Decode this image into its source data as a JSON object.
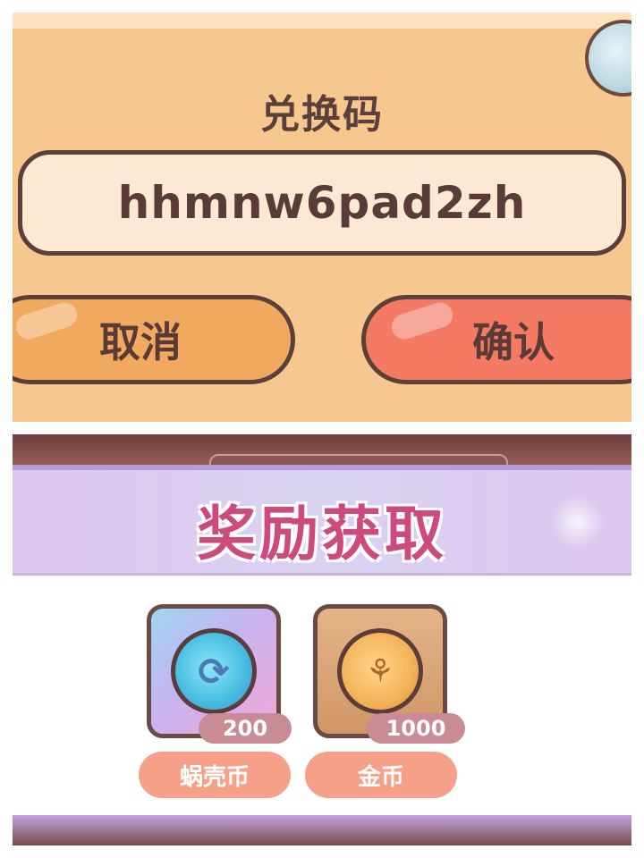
{
  "redeem_dialog": {
    "title": "兑换码",
    "code_value": "hhmnw6pad2zh",
    "cancel_label": "取消",
    "confirm_label": "确认"
  },
  "reward_popup": {
    "title": "奖励获取",
    "items": [
      {
        "name": "蜗壳币",
        "amount": "200",
        "icon": "swirl-coin-icon"
      },
      {
        "name": "金币",
        "amount": "1000",
        "icon": "gold-coin-icon"
      }
    ]
  },
  "colors": {
    "dialog_bg": "#f6c88f",
    "cancel_button": "#f1a85f",
    "confirm_button": "#f47a64",
    "reward_title": "#cc4a7c",
    "banner_bg": "#dcc7ef",
    "name_pill": "#f6a089"
  }
}
